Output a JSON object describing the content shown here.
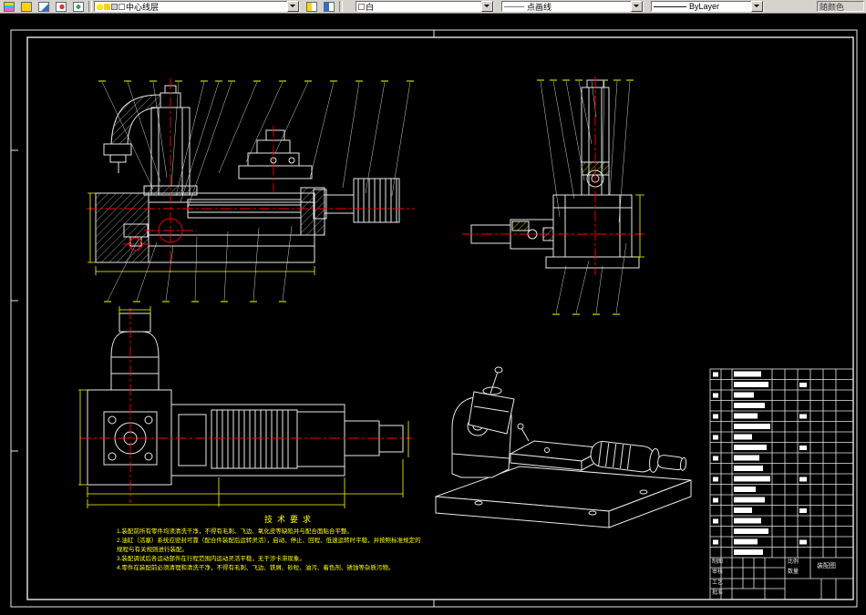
{
  "toolbar": {
    "layer_name": "中心线层",
    "color_name": "白",
    "linetype_preview": "—·—·—·",
    "linetype_name": "点画线",
    "lineweight_preview": "————",
    "lineweight_name": "ByLayer",
    "plot_style_name": "随颜色"
  },
  "tech_requirements": {
    "title": "技术要求",
    "items": [
      "1.装配前所有零件均须清洗干净，不得有毛刺、飞边、氧化皮等缺陷并与配合面贴合平整。",
      "2.油缸（活塞）系统应密封可靠（配合件装配后运转灵活），启动、停止、回程、低速运转时平稳，并按照标准规定的规程与有关规则进行装配。",
      "3.装配调试后各运动部件在行程范围内运动灵活平稳，无干涉卡滞现象。",
      "4.零件在装配前必须清理和清洗干净，不得有毛刺、飞边、铁屑、砂粒、油污、着色剂、锈蚀等杂质污物。"
    ]
  },
  "title_block": {
    "labels": [
      "制图",
      "审核",
      "工艺",
      "批准"
    ],
    "scale_label": "比例",
    "qty_label": "数量",
    "drawing_name": "装配图"
  },
  "colors": {
    "line": "#e8e8e8",
    "dimension": "#ffff00",
    "centerline": "#ff0000",
    "background": "#000000"
  }
}
